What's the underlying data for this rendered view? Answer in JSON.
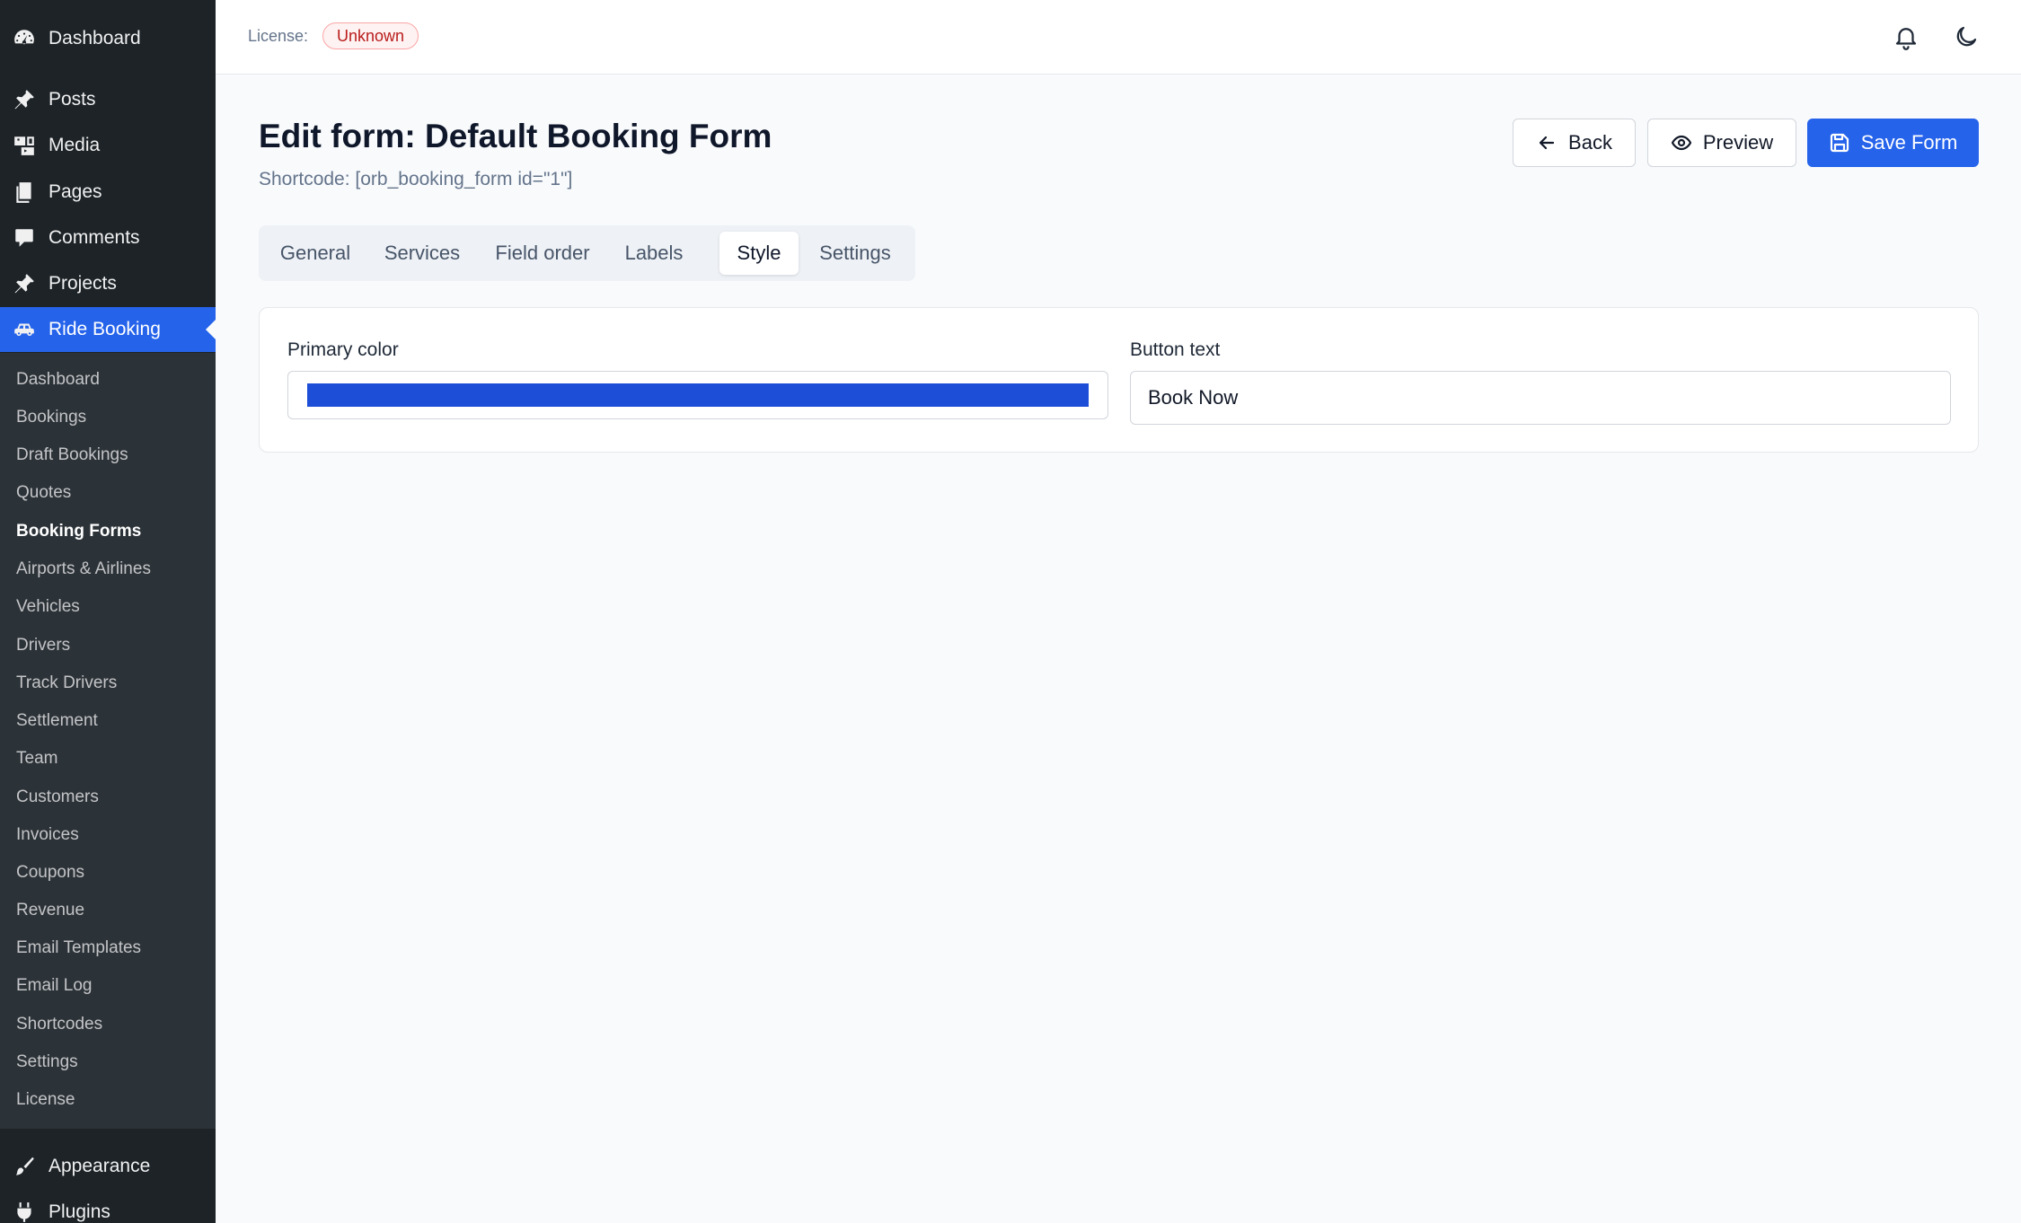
{
  "sidebar": {
    "top_items": [
      {
        "label": "Dashboard",
        "icon": "gauge-icon"
      },
      {
        "label": "Posts",
        "icon": "pin-icon"
      },
      {
        "label": "Media",
        "icon": "media-icon"
      },
      {
        "label": "Pages",
        "icon": "pages-icon"
      },
      {
        "label": "Comments",
        "icon": "comment-icon"
      },
      {
        "label": "Projects",
        "icon": "pin-icon"
      },
      {
        "label": "Ride Booking",
        "icon": "car-icon",
        "active": true
      }
    ],
    "submenu": [
      "Dashboard",
      "Bookings",
      "Draft Bookings",
      "Quotes",
      "Booking Forms",
      "Airports & Airlines",
      "Vehicles",
      "Drivers",
      "Track Drivers",
      "Settlement",
      "Team",
      "Customers",
      "Invoices",
      "Coupons",
      "Revenue",
      "Email Templates",
      "Email Log",
      "Shortcodes",
      "Settings",
      "License"
    ],
    "current_submenu": "Booking Forms",
    "bottom_items": [
      {
        "label": "Appearance",
        "icon": "brush-icon"
      },
      {
        "label": "Plugins",
        "icon": "plug-icon"
      }
    ]
  },
  "topbar": {
    "license_label": "License:",
    "license_status": "Unknown",
    "notifications_icon": "bell-icon",
    "theme_icon": "moon-icon"
  },
  "page": {
    "title": "Edit form: Default Booking Form",
    "shortcode": "Shortcode: [orb_booking_form id=\"1\"]"
  },
  "actions": {
    "back_label": "Back",
    "preview_label": "Preview",
    "save_label": "Save Form"
  },
  "tabs": [
    {
      "label": "General"
    },
    {
      "label": "Services"
    },
    {
      "label": "Field order"
    },
    {
      "label": "Labels"
    },
    {
      "label": "Style",
      "active": true
    },
    {
      "label": "Settings"
    }
  ],
  "style_panel": {
    "primary_color_label": "Primary color",
    "primary_color_value": "#1d4ed8",
    "button_text_label": "Button text",
    "button_text_value": "Book Now"
  },
  "colors": {
    "sidebar_bg": "#1d2327",
    "accent": "#2563eb",
    "license_badge": "#b91c1c"
  }
}
